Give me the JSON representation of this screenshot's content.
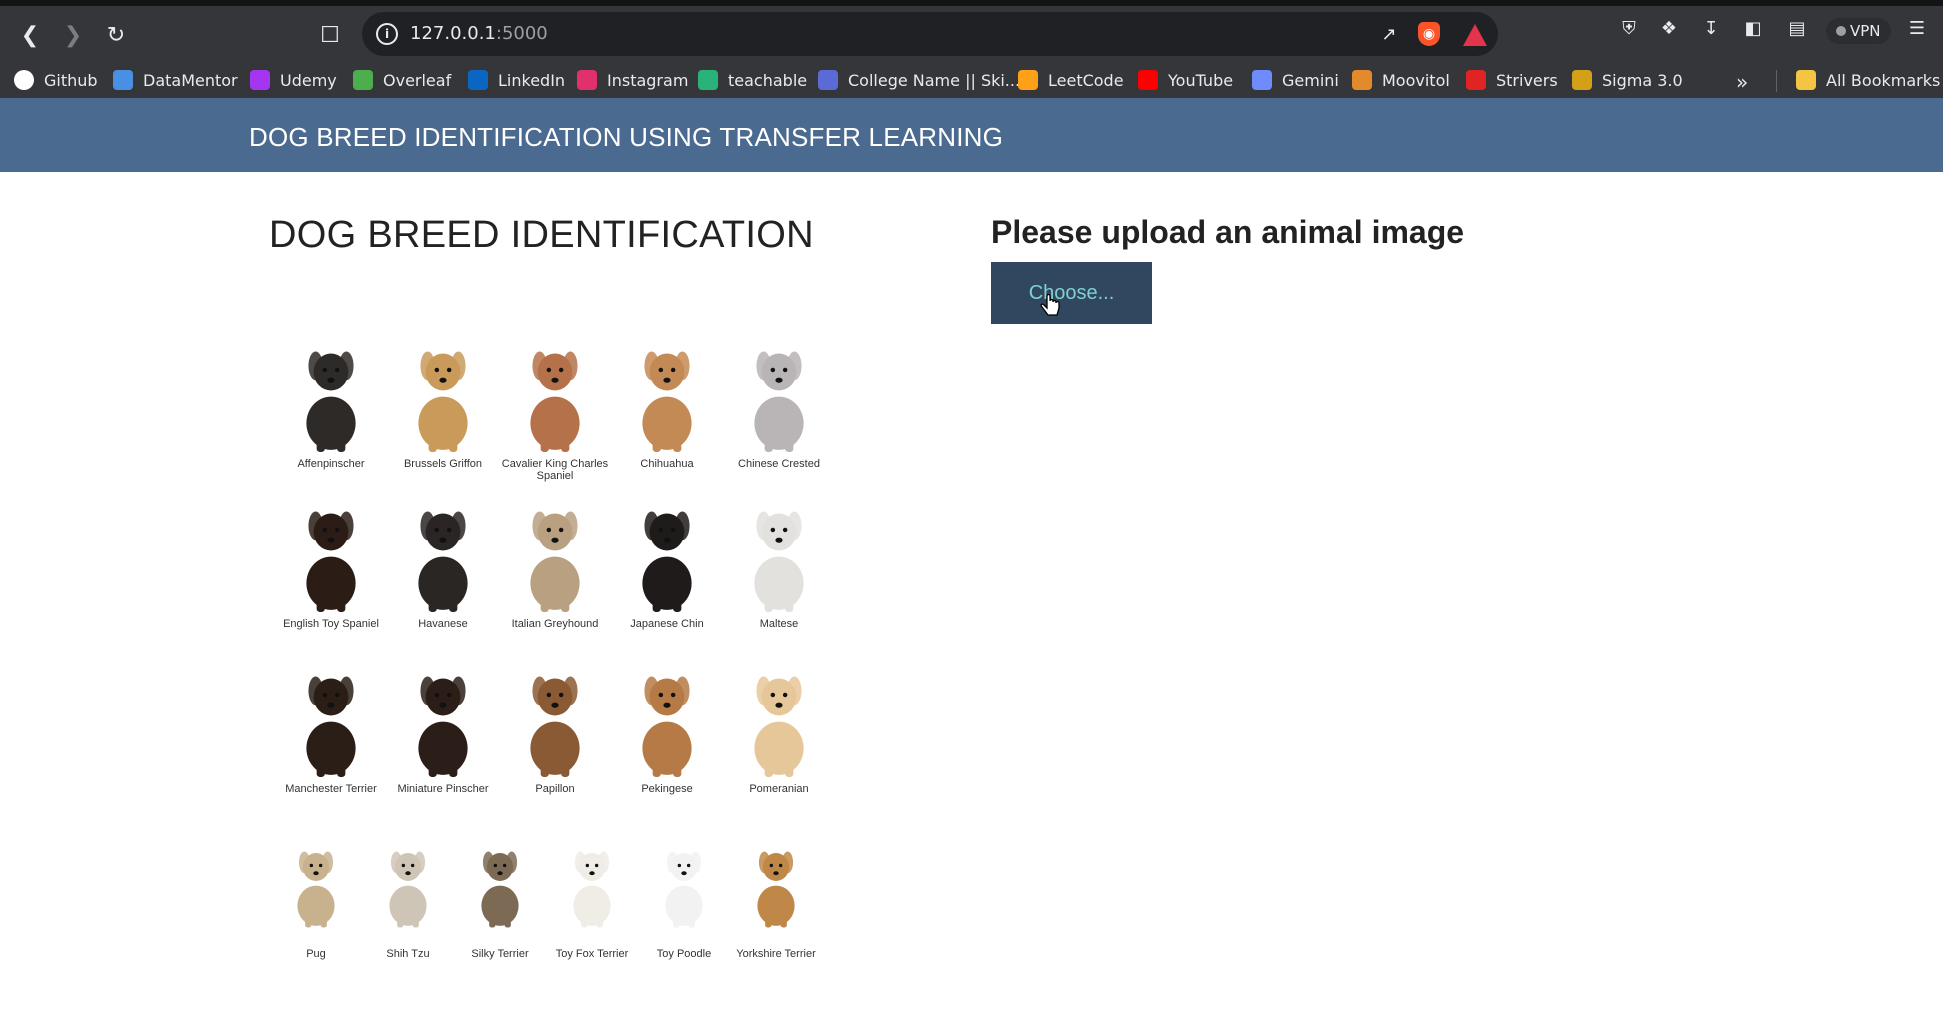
{
  "browser": {
    "url_host": "127.0.0.1",
    "url_port": ":5000",
    "vpn_label": "VPN",
    "bookmarks": [
      {
        "label": "Github",
        "icon": "github-icon",
        "color": "#ffffff"
      },
      {
        "label": "DataMentor",
        "icon": "datamentor-icon",
        "color": "#4a90e2"
      },
      {
        "label": "Udemy",
        "icon": "udemy-icon",
        "color": "#a435f0"
      },
      {
        "label": "Overleaf",
        "icon": "overleaf-icon",
        "color": "#4cae4c"
      },
      {
        "label": "LinkedIn",
        "icon": "linkedin-icon",
        "color": "#0a66c2"
      },
      {
        "label": "Instagram",
        "icon": "instagram-icon",
        "color": "#e1306c"
      },
      {
        "label": "teachable",
        "icon": "teachable-icon",
        "color": "#2ab27b"
      },
      {
        "label": "College Name || Ski...",
        "icon": "college-icon",
        "color": "#5b6bd5"
      },
      {
        "label": "LeetCode",
        "icon": "leetcode-icon",
        "color": "#ffa116"
      },
      {
        "label": "YouTube",
        "icon": "youtube-icon",
        "color": "#ff0000"
      },
      {
        "label": "Gemini",
        "icon": "gemini-icon",
        "color": "#6f8cff"
      },
      {
        "label": "Moovitol",
        "icon": "moovitol-icon",
        "color": "#e38b2c"
      },
      {
        "label": "Strivers",
        "icon": "strivers-icon",
        "color": "#e02424"
      },
      {
        "label": "Sigma 3.0",
        "icon": "sigma-icon",
        "color": "#d4a017"
      }
    ],
    "all_bookmarks_label": "All Bookmarks"
  },
  "page": {
    "navbar_title": "DOG BREED IDENTIFICATION USING TRANSFER LEARNING",
    "main_title": "DOG BREED IDENTIFICATION",
    "upload_heading": "Please upload an animal image",
    "choose_button": "Choose..."
  },
  "breeds": [
    [
      "Affenpinscher",
      "Brussels Griffon",
      "Cavalier King Charles Spaniel",
      "Chihuahua",
      "Chinese Crested"
    ],
    [
      "English Toy Spaniel",
      "Havanese",
      "Italian Greyhound",
      "Japanese Chin",
      "Maltese"
    ],
    [
      "Manchester Terrier",
      "Miniature Pinscher",
      "Papillon",
      "Pekingese",
      "Pomeranian"
    ],
    [
      "Pug",
      "Shih Tzu",
      "Silky Terrier",
      "Toy Fox Terrier",
      "Toy Poodle",
      "Yorkshire Terrier"
    ]
  ],
  "breed_colors": [
    [
      "#2e2a28",
      "#c99a5a",
      "#b5724a",
      "#c48a55",
      "#b9b4b6"
    ],
    [
      "#2b1d16",
      "#2a2624",
      "#b8a080",
      "#1f1b1a",
      "#e3e1de"
    ],
    [
      "#2a1e17",
      "#2b1e18",
      "#8a5a35",
      "#b57a45",
      "#e6c79a"
    ],
    [
      "#c8b28e",
      "#cfc5b6",
      "#7d6a54",
      "#f0ece6",
      "#f2f2f2",
      "#c08848"
    ]
  ]
}
